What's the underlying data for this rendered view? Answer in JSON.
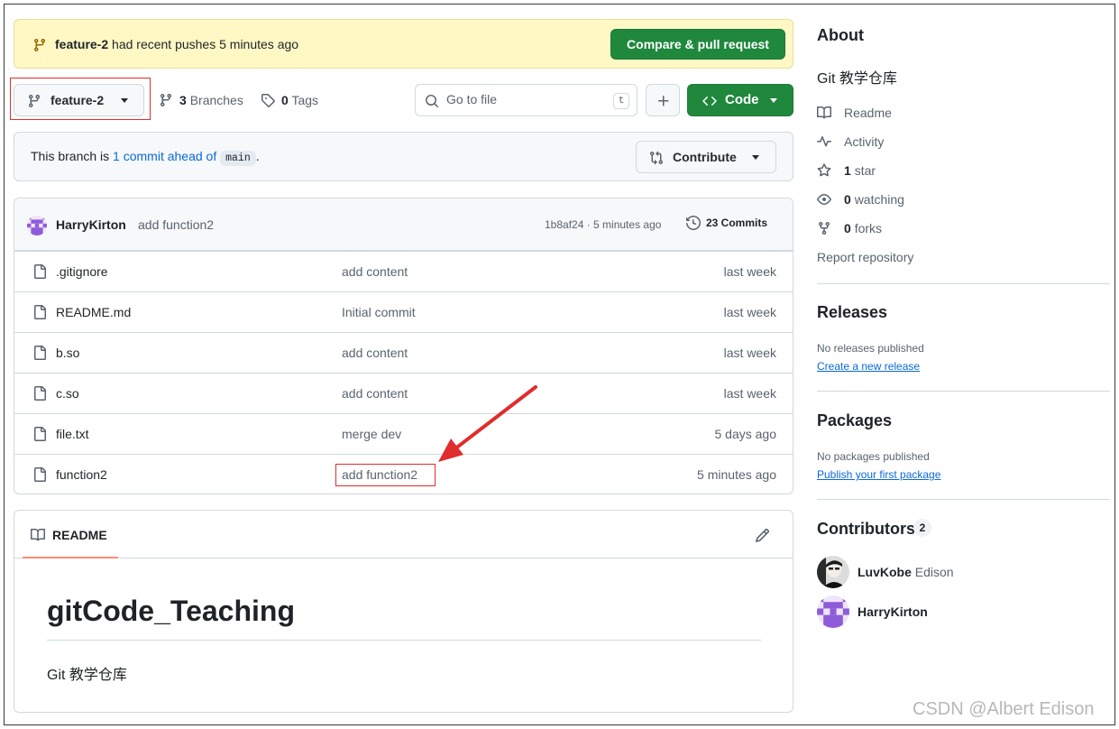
{
  "banner": {
    "branch": "feature-2",
    "message": " had recent pushes 5 minutes ago",
    "button": "Compare & pull request"
  },
  "toolbar": {
    "branch": "feature-2",
    "branches_count": "3",
    "branches_label": "Branches",
    "tags_count": "0",
    "tags_label": "Tags",
    "goto_placeholder": "Go to file",
    "goto_shortcut": "t",
    "code_label": "Code"
  },
  "ahead": {
    "prefix": "This branch is ",
    "link": "1 commit ahead of",
    "base": "main",
    "suffix": ".",
    "contribute": "Contribute"
  },
  "latest_commit": {
    "author": "HarryKirton",
    "message": "add function2",
    "sha_time": "1b8af24 · 5 minutes ago",
    "commits": "23 Commits"
  },
  "files": [
    {
      "name": ".gitignore",
      "message": "add content",
      "time": "last week"
    },
    {
      "name": "README.md",
      "message": "Initial commit",
      "time": "last week"
    },
    {
      "name": "b.so",
      "message": "add content",
      "time": "last week"
    },
    {
      "name": "c.so",
      "message": "add content",
      "time": "last week"
    },
    {
      "name": "file.txt",
      "message": "merge dev",
      "time": "5 days ago"
    },
    {
      "name": "function2",
      "message": "add function2",
      "time": "5 minutes ago"
    }
  ],
  "readme": {
    "tab": "README",
    "title": "gitCode_Teaching",
    "body": "Git 教学仓库"
  },
  "sidebar": {
    "about_title": "About",
    "description": "Git 教学仓库",
    "readme": "Readme",
    "activity": "Activity",
    "stars_count": "1",
    "stars_label": "star",
    "watching_count": "0",
    "watching_label": "watching",
    "forks_count": "0",
    "forks_label": "forks",
    "report": "Report repository",
    "releases_title": "Releases",
    "releases_none": "No releases published",
    "releases_link": "Create a new release",
    "packages_title": "Packages",
    "packages_none": "No packages published",
    "packages_link": "Publish your first package",
    "contributors_title": "Contributors",
    "contributors_count": "2",
    "contributors": [
      {
        "login": "LuvKobe",
        "name": "Edison"
      },
      {
        "login": "HarryKirton",
        "name": ""
      }
    ]
  },
  "watermark": "CSDN @Albert Edison",
  "colors": {
    "accent_green": "#1f883d",
    "link_blue": "#0969da",
    "banner_yellow": "#fff8c5",
    "annotation_red": "#e02d2d"
  }
}
